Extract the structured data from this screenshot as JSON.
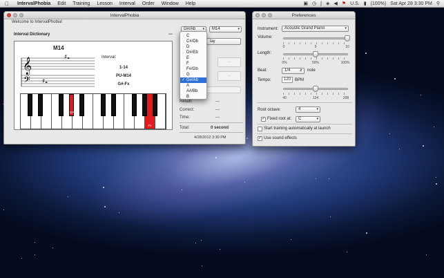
{
  "menubar": {
    "app_name": "IntervalPhobia",
    "items": [
      "Edit",
      "Training",
      "Lesson",
      "Interval",
      "Order",
      "Window",
      "Help"
    ],
    "input_source": "U.S.",
    "battery": "(100%)",
    "clock": "Sat Apr 28  3:30 PM"
  },
  "main_window": {
    "title": "IntervalPhobia",
    "welcome": "Welcome to IntervalPhobia!",
    "dictionary_title": "Interval Dictionary",
    "dictionary_value": "---",
    "interval_name": "M14",
    "interval_label": "Interval:",
    "interval_lines": [
      "1-14",
      "PU-M14",
      "G#-Fx"
    ],
    "root_select": "G#/Ab",
    "interval_select": "M14",
    "play_button": "lay",
    "key_labels": {
      "low": "G#",
      "high": "Fx"
    },
    "results": [
      {
        "label": "Result:",
        "value": "---"
      },
      {
        "label": "Correct:",
        "value": "---"
      },
      {
        "label": "Time:",
        "value": "---"
      }
    ],
    "total_label": "Total:",
    "total_value": "0 second",
    "timestamp": "4/28/2012 3:30 PM"
  },
  "root_dropdown": {
    "options": [
      "C",
      "C#/Db",
      "D",
      "D#/Eb",
      "E",
      "F",
      "F#/Gb",
      "G",
      "G#/Ab",
      "A",
      "A#/Bb",
      "B"
    ],
    "selected": "G#/Ab"
  },
  "prefs_window": {
    "title": "Preferences",
    "instrument_label": "Instrument:",
    "instrument_value": "Acoustic Grand Piano",
    "volume_label": "Volume:",
    "volume_ticks": [
      "0",
      "5",
      "10"
    ],
    "volume_level": 10,
    "length_label": "Length:",
    "length_ticks": [
      "0%",
      "50%",
      "100%"
    ],
    "length_level_percent": 50,
    "beat_label": "Beat:",
    "beat_value": "1/4",
    "beat_unit": "note",
    "tempo_label": "Tempo:",
    "tempo_value": "120",
    "tempo_unit": "BPM",
    "tempo_ticks": [
      "40",
      "124",
      "208"
    ],
    "tempo_level": 124,
    "root_octave_label": "Root octave:",
    "root_octave_value": "4",
    "fixed_root_label": "Fixed root at:",
    "fixed_root_value": "C",
    "fixed_root_checked": true,
    "auto_start_label": "Start training automatically at launch",
    "auto_start_checked": false,
    "sound_effects_label": "Use sound effects",
    "sound_effects_checked": true
  },
  "colors": {
    "highlight_key": "#e11c1c",
    "selection_blue": "#2f6fd6"
  }
}
